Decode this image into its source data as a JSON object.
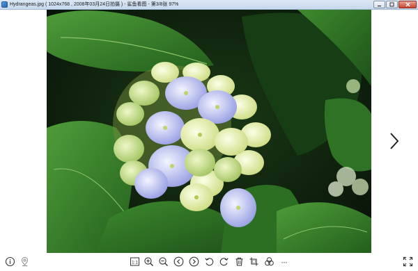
{
  "window": {
    "title": "Hydrangeas.jpg ( 1024x768 , 2008年03月24日拍摄 ) - 鲨鱼看图 - 第3/8张 97%"
  },
  "image": {
    "description_icon": "photo-icon"
  },
  "colors": {
    "titlebar": "#c7d9ee",
    "close": "#c8452f",
    "icon_stroke": "#333333"
  },
  "toolbar": {
    "actual_size_label": "1:1",
    "more_label": "···"
  }
}
